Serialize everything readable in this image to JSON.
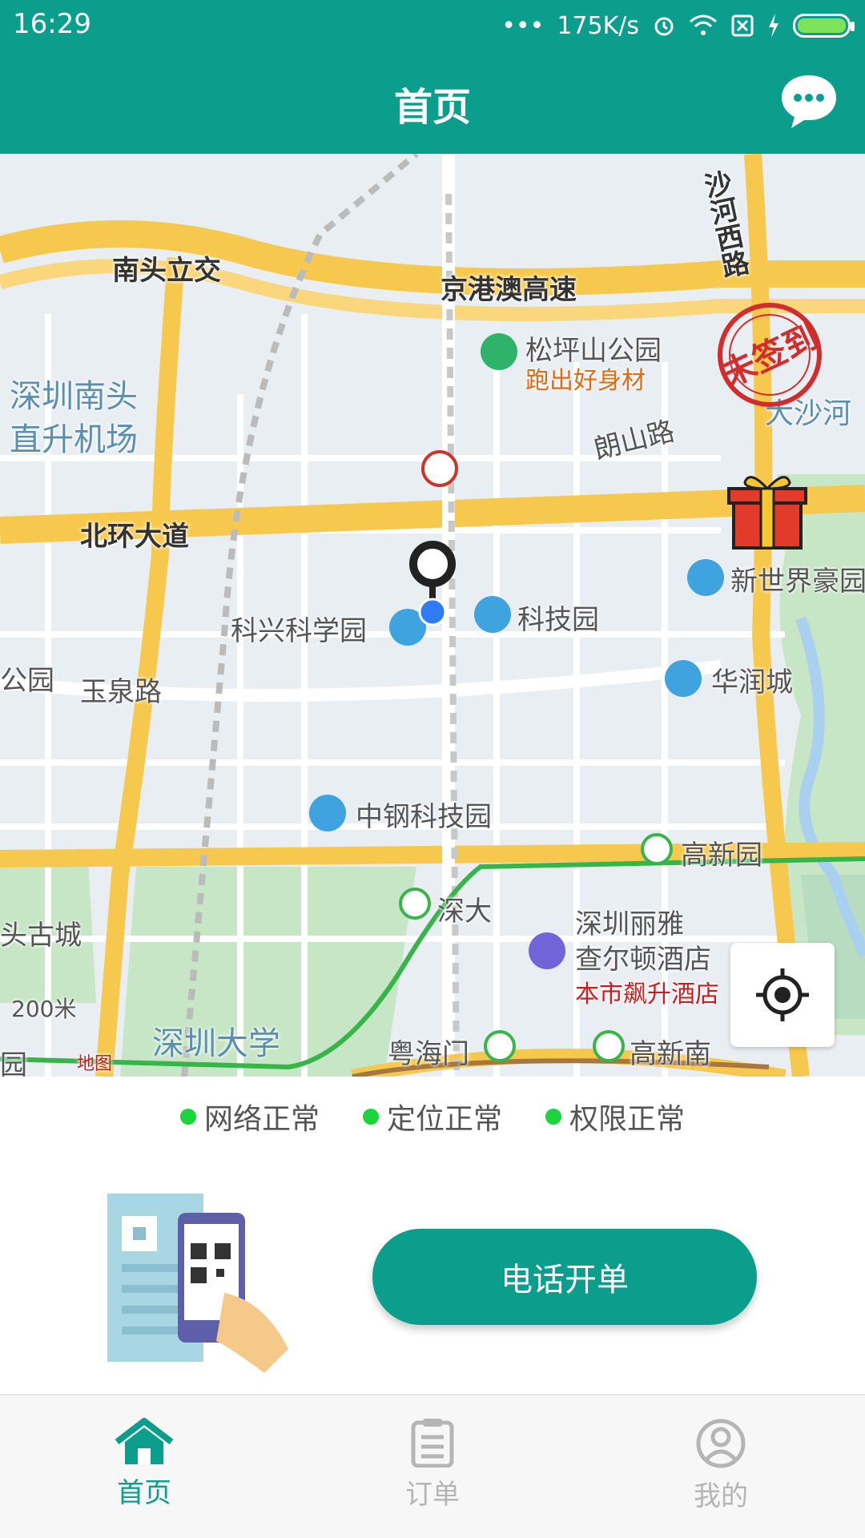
{
  "status_bar": {
    "time": "16:29",
    "dots": "•••",
    "net_speed": "175K/s"
  },
  "app_bar": {
    "title": "首页"
  },
  "map": {
    "labels": {
      "nantou_lijiao": "南头立交",
      "jinggangao": "京港澳高速",
      "shahexi": "沙河西路",
      "songpingshan": "松坪山公园",
      "paochu": "跑出好身材",
      "nantou_airport_1": "深圳南头",
      "nantou_airport_2": "直升机场",
      "langshan": "朗山路",
      "dashahe": "大沙河",
      "beihuan": "北环大道",
      "xinshijie": "新世界豪园",
      "kexing": "科兴科学园",
      "kejiyuan": "科技园",
      "huarun": "华润城",
      "gongyuan": "公园",
      "yuquan": "玉泉路",
      "zhonggang": "中钢科技园",
      "gaoxinyuan": "高新园",
      "shenda": "深大",
      "gucheng": "头古城",
      "liya_1": "深圳丽雅",
      "liya_2": "查尔顿酒店",
      "biaosheng": "本市飙升酒店",
      "scale": "200米",
      "shenzhen_univ": "深圳大学",
      "yuehaimen": "粤海门",
      "gaoxinnan": "高新南",
      "yuan": "园",
      "map_logo": "地图",
      "stamp": "未签到"
    }
  },
  "status_strip": {
    "items": [
      {
        "label": "网络正常"
      },
      {
        "label": "定位正常"
      },
      {
        "label": "权限正常"
      }
    ]
  },
  "panel": {
    "phone_order_label": "电话开单"
  },
  "bottom_nav": {
    "items": [
      {
        "label": "首页"
      },
      {
        "label": "订单"
      },
      {
        "label": "我的"
      }
    ]
  },
  "colors": {
    "primary": "#0b9e8d",
    "status_ok": "#1cd43c",
    "nav_inactive": "#b5b5b5"
  }
}
